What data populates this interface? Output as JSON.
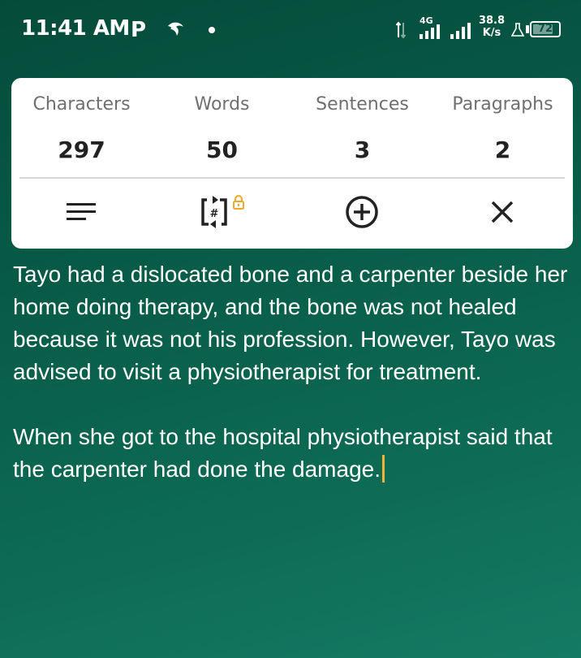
{
  "status_bar": {
    "time": "11:41 AM",
    "app_icon_letter": "P",
    "network_type": "4G",
    "network_speed_value": "38.8",
    "network_speed_unit": "K/s",
    "battery_level": "72",
    "icons": [
      "p-app-icon",
      "bird-app-icon",
      "notification-dot-icon",
      "data-arrows-icon",
      "signal-icon",
      "flask-icon",
      "battery-icon"
    ]
  },
  "stats": {
    "columns": [
      {
        "label": "Characters",
        "value": "297"
      },
      {
        "label": "Words",
        "value": "50"
      },
      {
        "label": "Sentences",
        "value": "3"
      },
      {
        "label": "Paragraphs",
        "value": "2"
      }
    ]
  },
  "actions": {
    "icons": [
      "format-lines-icon",
      "hash-convert-icon",
      "add-circle-icon",
      "close-icon"
    ],
    "locked_badge": "lock-icon",
    "lock_color": "#f0a92a"
  },
  "text": {
    "paragraphs": [
      "Tayo had a dislocated bone and a carpenter beside her home doing therapy, and the bone was not healed because it was not his profession. However, Tayo was advised to visit a physiotherapist for treatment.",
      "When she got to the hospital physiotherapist said that the carpenter had done the damage."
    ],
    "caret_color": "#f3b234"
  },
  "colors": {
    "background": "#075a46",
    "card": "#ffffff",
    "label_text": "#6f6f6f",
    "value_text": "#222222"
  }
}
